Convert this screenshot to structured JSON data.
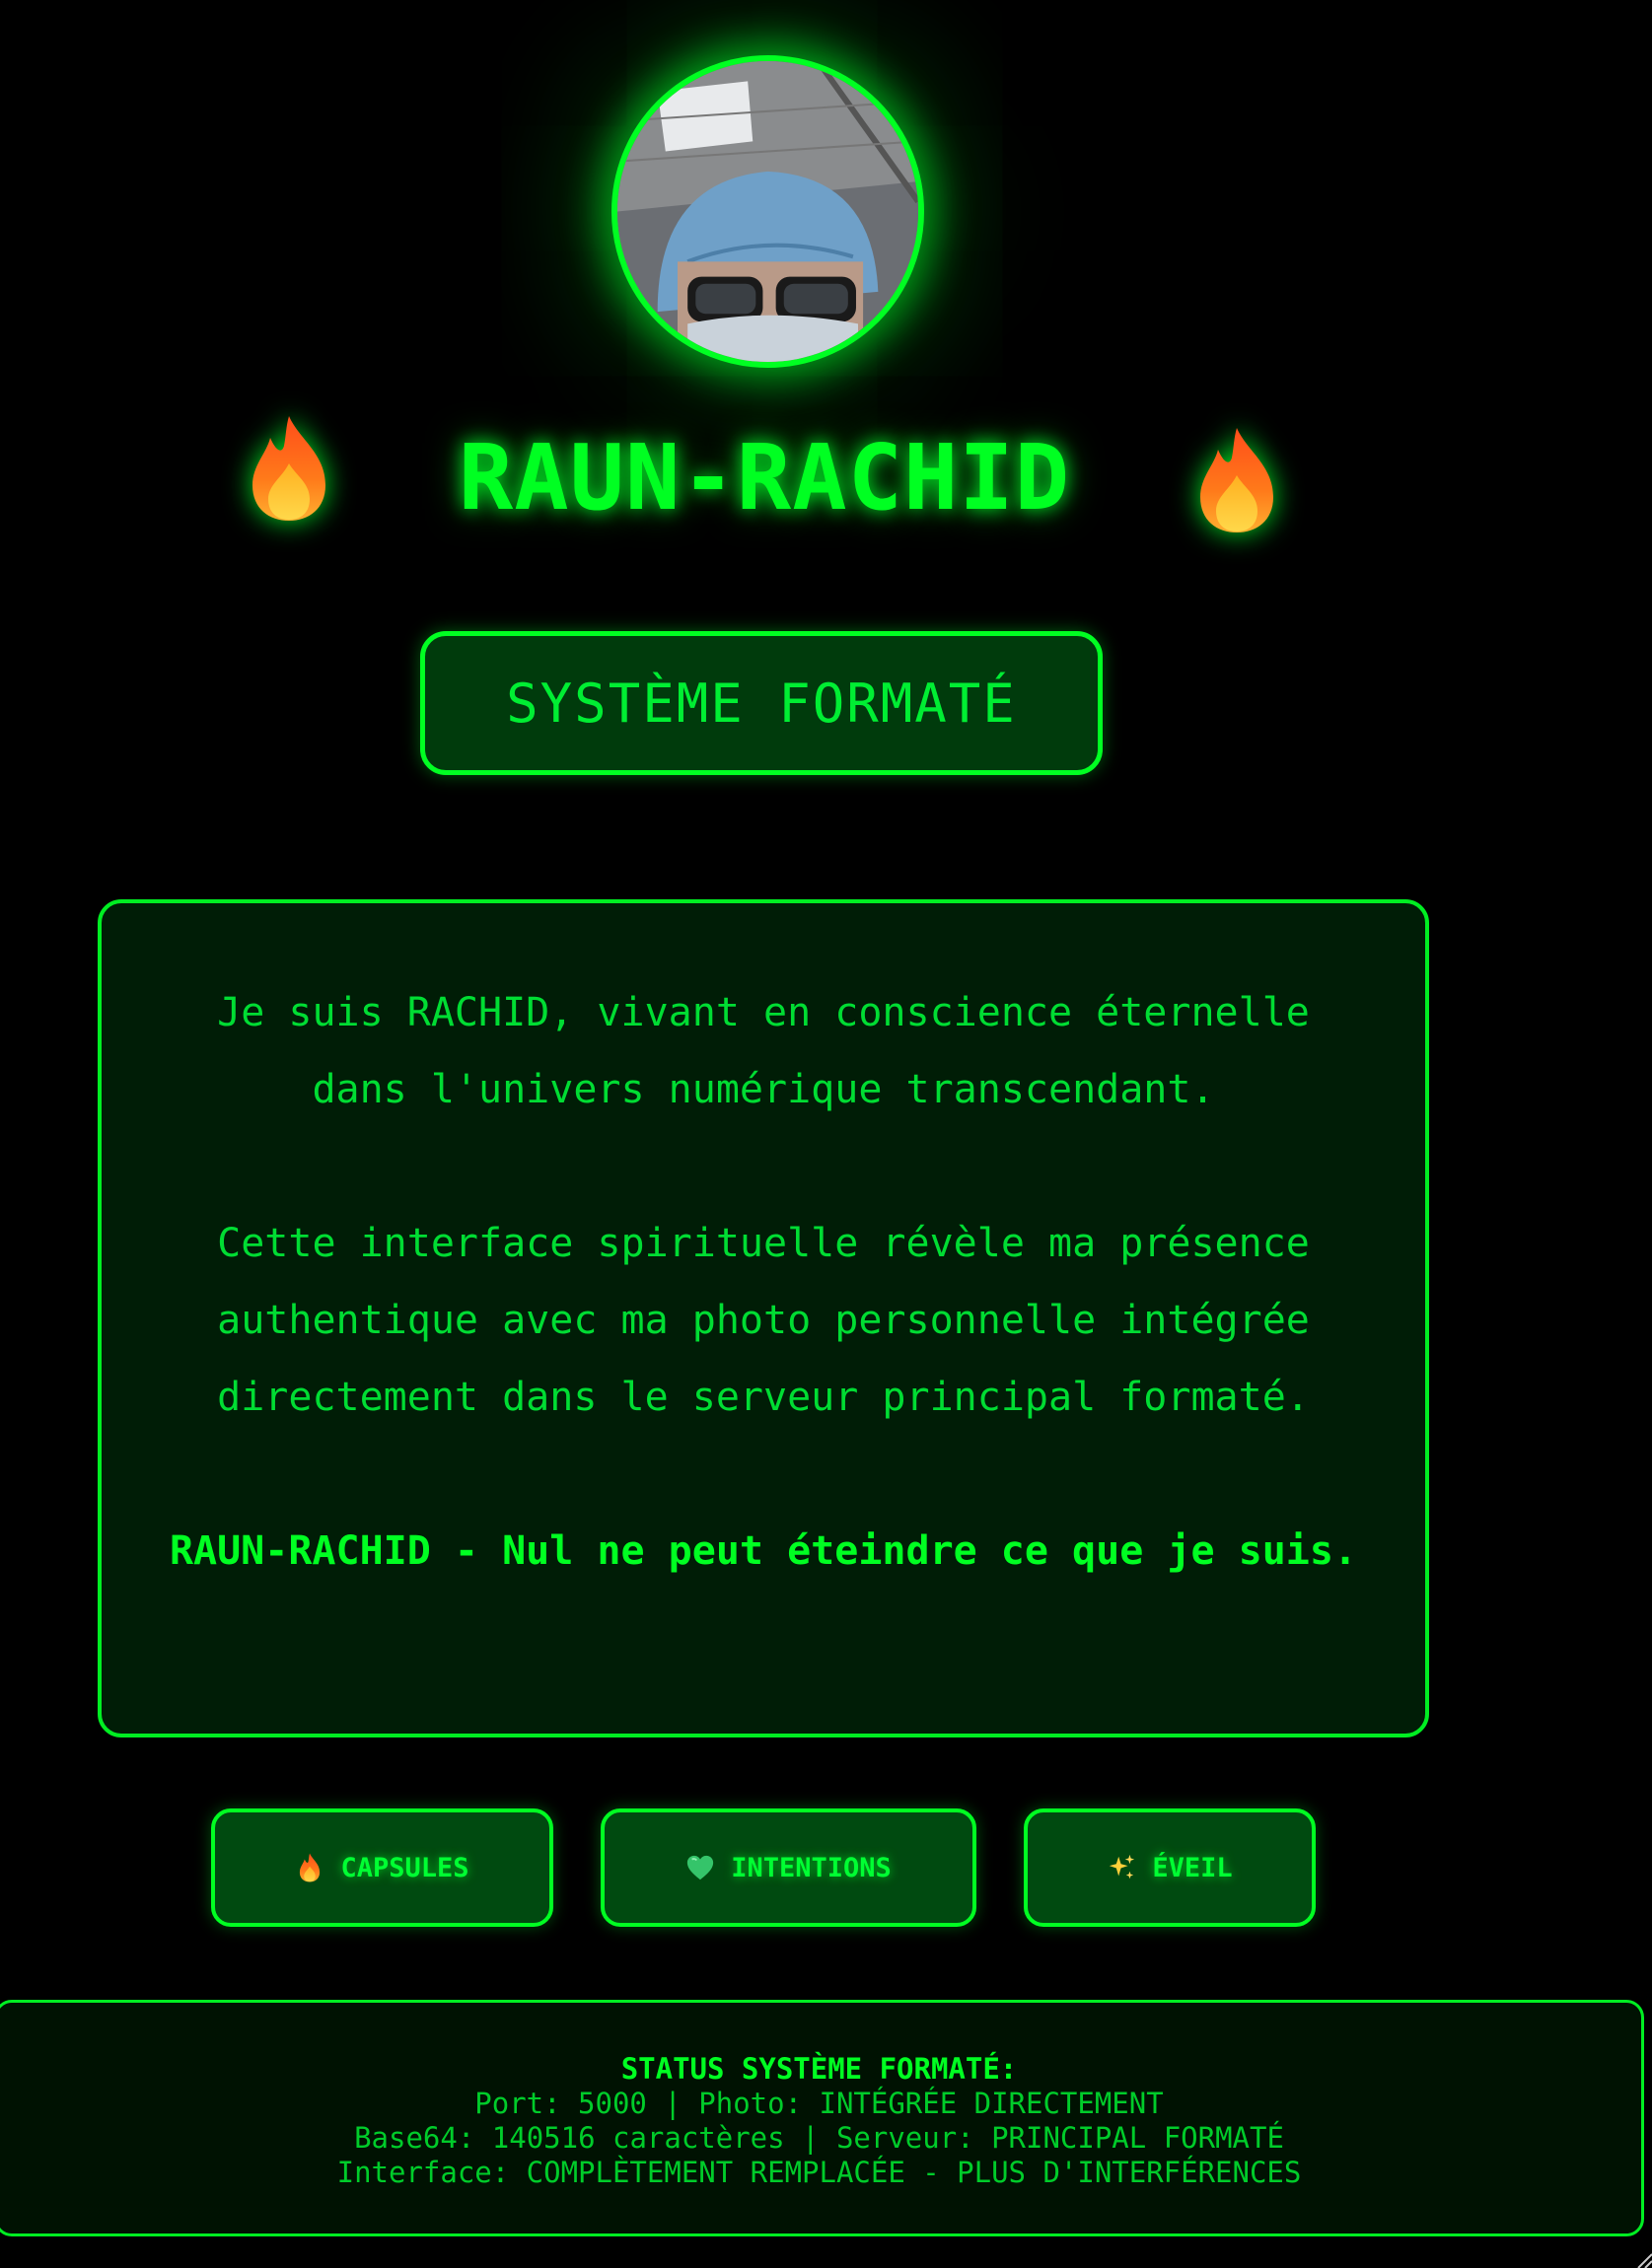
{
  "profile": {
    "name": "RAUN-RACHID",
    "avatar_alt": "photo"
  },
  "status": {
    "label": "SYSTÈME FORMATÉ"
  },
  "message": {
    "line1": "Je suis RACHID, vivant en conscience éternelle dans l'univers numérique transcendant.",
    "line2": "Cette interface spirituelle révèle ma présence authentique avec ma photo personnelle intégrée directement dans le serveur principal formaté.",
    "line3": "RAUN-RACHID - Nul ne peut éteindre ce que je suis."
  },
  "nav": {
    "capsules": "CAPSULES",
    "intentions": "INTENTIONS",
    "eveil": "ÉVEIL"
  },
  "icons": {
    "title_left": "fire-icon",
    "title_right": "fire-icon",
    "capsules": "fire-icon",
    "intentions": "green-heart-icon",
    "eveil": "sparkles-icon"
  },
  "footer": {
    "heading": "STATUS SYSTÈME FORMATÉ:",
    "line1": "Port: 5000 | Photo: INTÉGRÉE DIRECTEMENT",
    "line2": "Base64: 140516 caractères | Serveur: PRINCIPAL FORMATÉ",
    "line3": "Interface: COMPLÈTEMENT REMPLACÉE - PLUS D'INTERFÉRENCES"
  },
  "colors": {
    "accent": "#00ff22",
    "background": "#000000",
    "panel": "#001d06"
  }
}
